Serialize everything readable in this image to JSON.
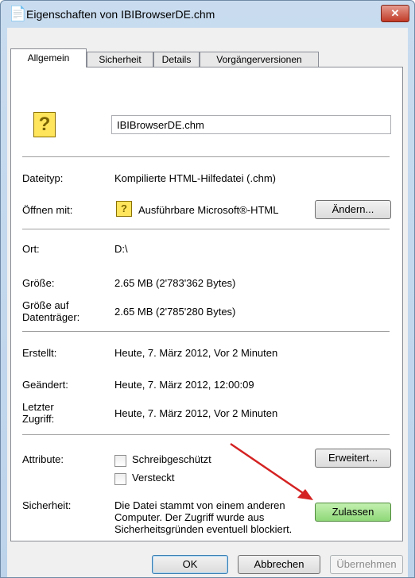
{
  "window": {
    "title": "Eigenschaften von IBIBrowserDE.chm",
    "close_glyph": "✕"
  },
  "tabs": [
    "Allgemein",
    "Sicherheit",
    "Details",
    "Vorgängerversionen"
  ],
  "file": {
    "name": "IBIBrowserDE.chm"
  },
  "rows": {
    "type": {
      "label": "Dateityp:",
      "value": "Kompilierte HTML-Hilfedatei (.chm)"
    },
    "open_with": {
      "label": "Öffnen mit:",
      "value": "Ausführbare Microsoft®-HTML",
      "button": "Ändern..."
    },
    "location": {
      "label": "Ort:",
      "value": "D:\\"
    },
    "size": {
      "label": "Größe:",
      "value": "2.65 MB (2'783'362 Bytes)"
    },
    "size_on_disk": {
      "label": "Größe auf Datenträger:",
      "value": "2.65 MB (2'785'280 Bytes)"
    },
    "created": {
      "label": "Erstellt:",
      "value": "Heute, 7. März 2012, Vor 2 Minuten"
    },
    "modified": {
      "label": "Geändert:",
      "value": "Heute, 7. März 2012, 12:00:09"
    },
    "accessed": {
      "label": "Letzter Zugriff:",
      "value": "Heute, 7. März 2012, Vor 2 Minuten"
    },
    "attributes": {
      "label": "Attribute:",
      "readonly": "Schreibgeschützt",
      "hidden": "Versteckt",
      "advanced_button": "Erweitert..."
    },
    "security": {
      "label": "Sicherheit:",
      "text": "Die Datei stammt von einem anderen Computer. Der Zugriff wurde aus Sicherheitsgründen eventuell blockiert.",
      "unblock_button": "Zulassen"
    }
  },
  "footer": {
    "ok": "OK",
    "cancel": "Abbrechen",
    "apply": "Übernehmen"
  },
  "colors": {
    "accent_green": "#8fd879",
    "arrow_red": "#d42222"
  },
  "icons": {
    "file": "chm-help-file-icon",
    "app": "html-help-app-icon"
  }
}
